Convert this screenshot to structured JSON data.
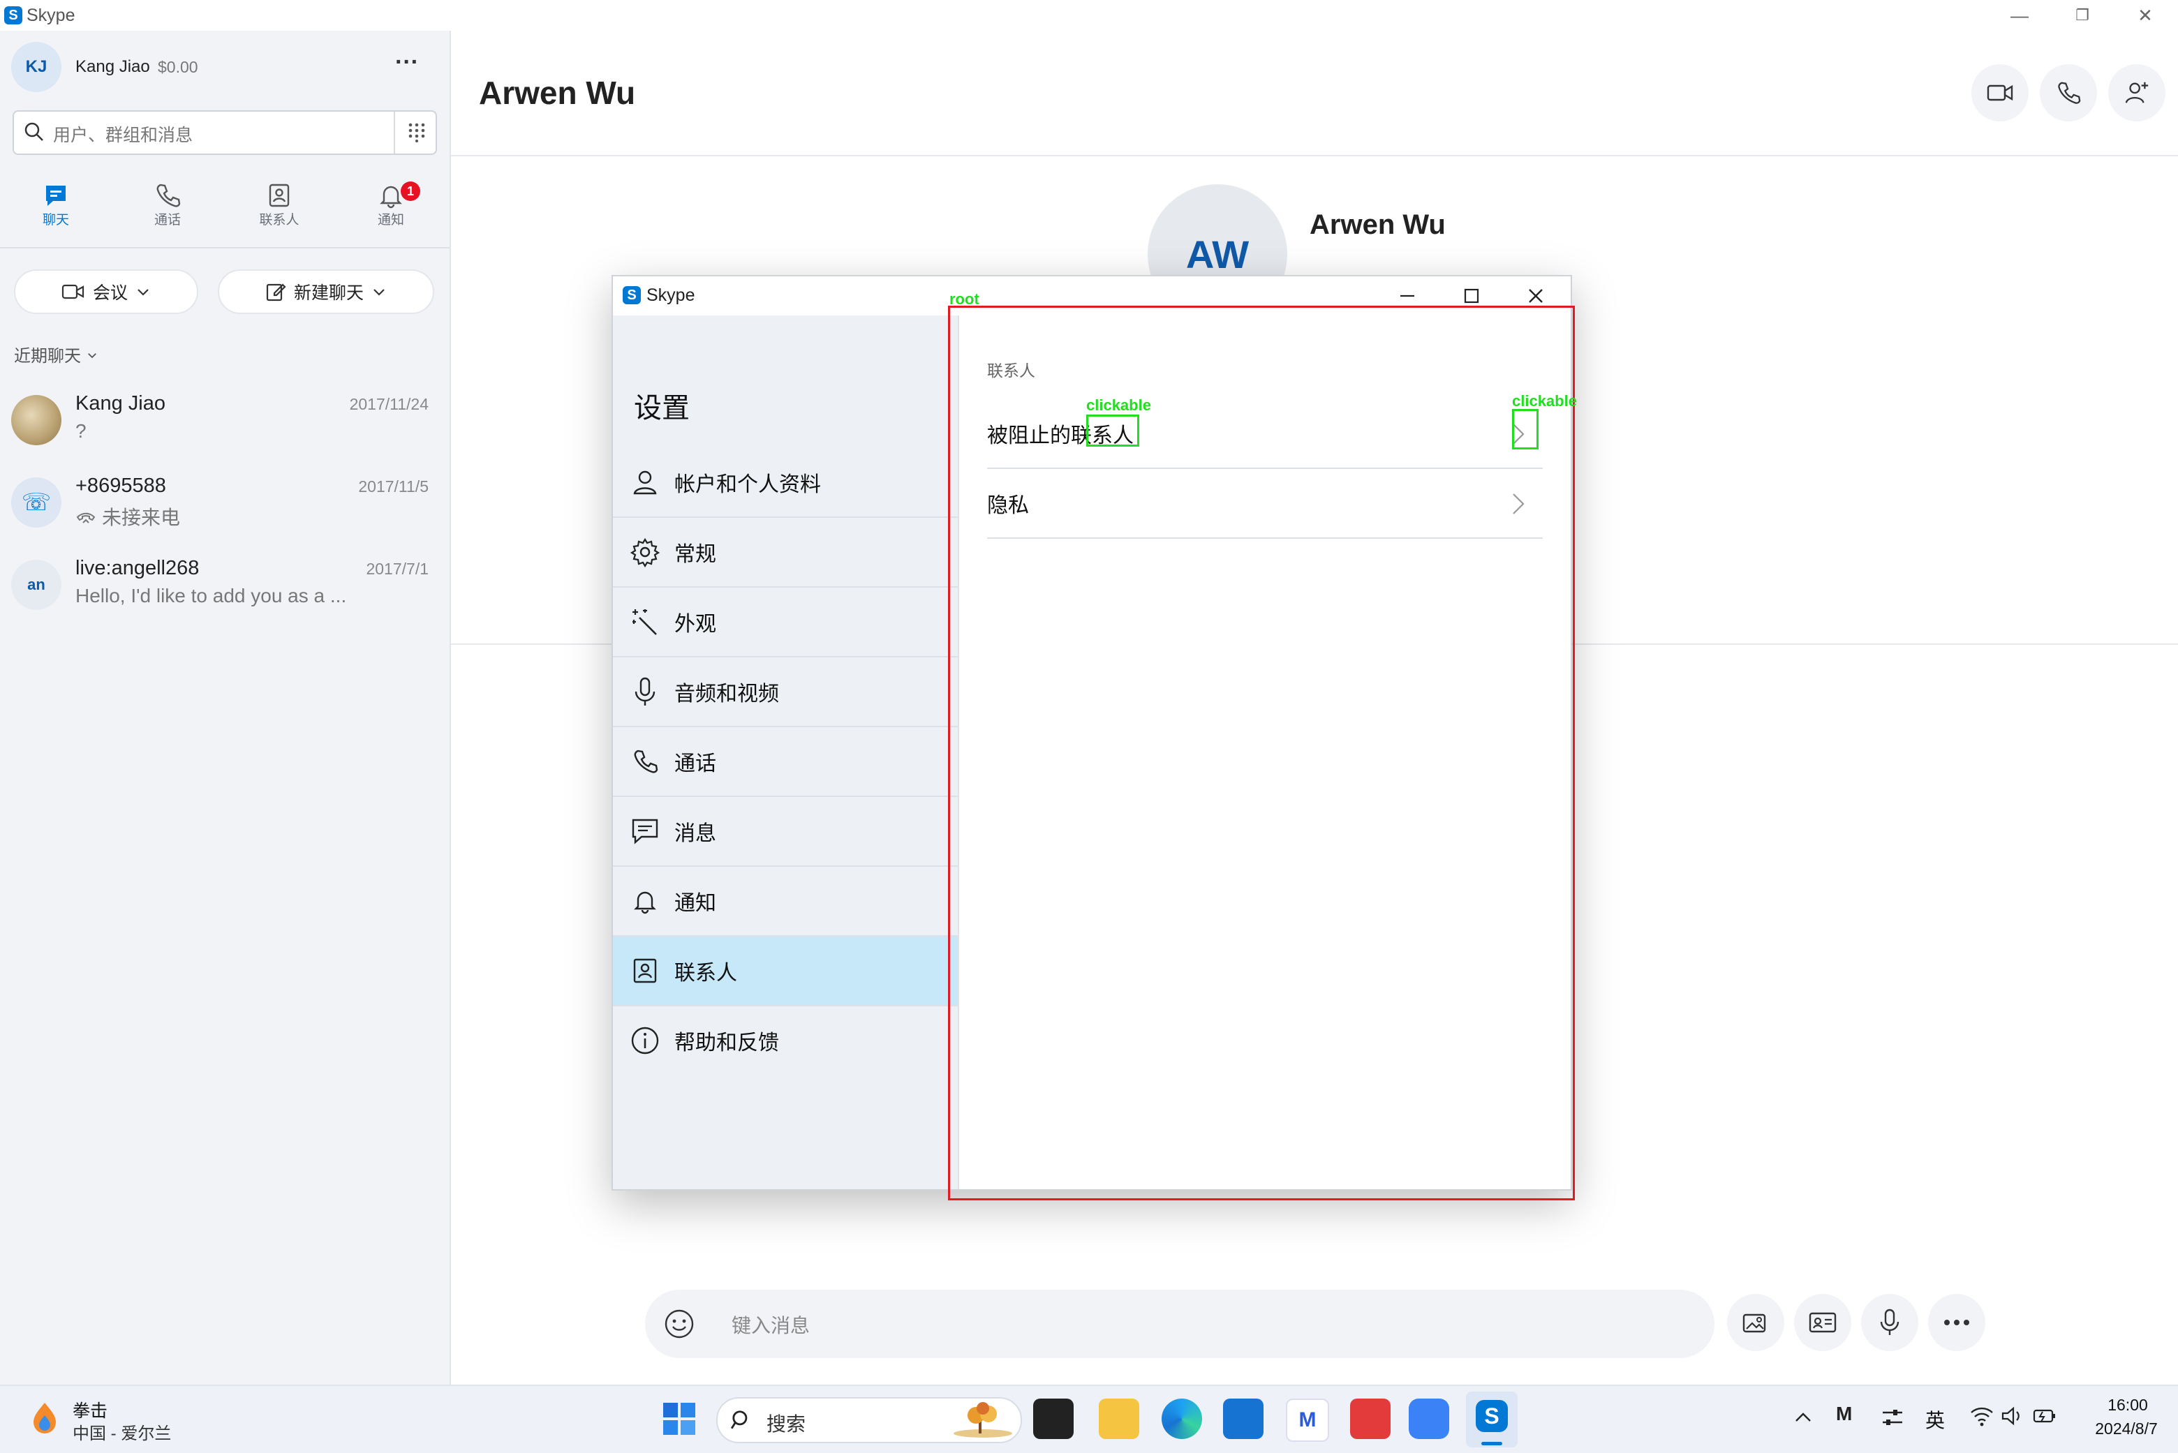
{
  "app": {
    "title": "Skype"
  },
  "window_controls": {
    "minimize": "—",
    "restore": "❐",
    "close": "✕"
  },
  "profile": {
    "initials": "KJ",
    "name": "Kang Jiao",
    "balance": "$0.00",
    "more": "···"
  },
  "search": {
    "placeholder": "用户、群组和消息"
  },
  "nav": [
    {
      "label": "聊天"
    },
    {
      "label": "通话"
    },
    {
      "label": "联系人"
    },
    {
      "label": "通知",
      "badge": "1"
    }
  ],
  "actions": {
    "meeting": "会议",
    "new_chat": "新建聊天"
  },
  "recent": {
    "label": "近期聊天",
    "chats": [
      {
        "name": "Kang Jiao",
        "date": "2017/11/24",
        "message": "?"
      },
      {
        "name": "+8695588",
        "date": "2017/11/5",
        "message": "未接来电"
      },
      {
        "name": "live:angell268",
        "date": "2017/7/1",
        "message": "Hello, I'd like to add you as a ...",
        "initials": "an"
      }
    ]
  },
  "conversation": {
    "title": "Arwen Wu",
    "contact_initials": "AW",
    "contact_name": "Arwen Wu",
    "composer_placeholder": "键入消息"
  },
  "dialog": {
    "title": "Skype",
    "heading": "设置",
    "menu": [
      {
        "label": "帐户和个人资料",
        "icon": "person-icon"
      },
      {
        "label": "常规",
        "icon": "gear-icon"
      },
      {
        "label": "外观",
        "icon": "magic-wand-icon"
      },
      {
        "label": "音频和视频",
        "icon": "microphone-icon"
      },
      {
        "label": "通话",
        "icon": "phone-icon"
      },
      {
        "label": "消息",
        "icon": "message-icon"
      },
      {
        "label": "通知",
        "icon": "bell-icon"
      },
      {
        "label": "联系人",
        "icon": "contact-card-icon",
        "active": true
      },
      {
        "label": "帮助和反馈",
        "icon": "info-icon"
      }
    ],
    "section_title": "联系人",
    "rows": [
      {
        "label": "被阻止的联系人"
      },
      {
        "label": "隐私"
      }
    ]
  },
  "annotations": {
    "root": "root",
    "clickable_1": "clickable",
    "clickable_2": "clickable"
  },
  "taskbar": {
    "weather_title": "拳击",
    "weather_sub": "中国 - 爱尔兰",
    "search_placeholder": "搜索",
    "ime": "英",
    "time": "16:00",
    "date": "2024/8/7"
  },
  "colors": {
    "accent": "#0078d4",
    "badge": "#e81123",
    "selected": "#c7e8f8",
    "annotation_red": "#e01b24",
    "annotation_green": "#22dd22"
  }
}
